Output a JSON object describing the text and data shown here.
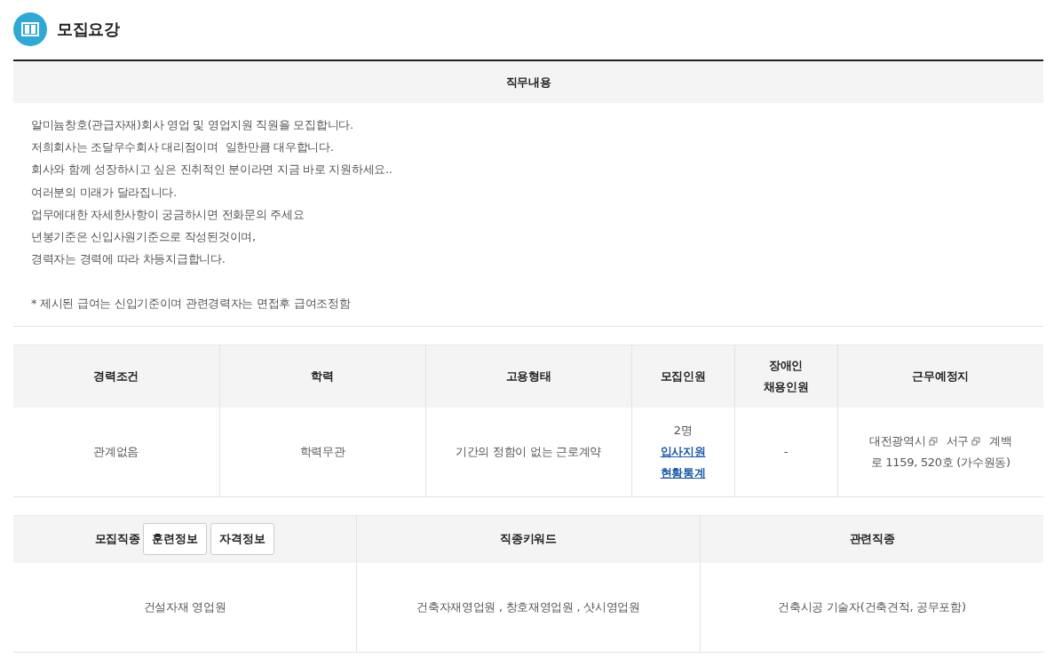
{
  "section_title": "모집요강",
  "job_description": {
    "heading": "직무내용",
    "lines": [
      "알미늄창호(관급자재)회사 영업 및 영업지원 직원을 모집합니다.",
      "저희회사는 조달우수회사 대리점이며  일한만큼 대우합니다.",
      "회사와 함께 성장하시고 싶은 진취적인 분이라면 지금 바로 지원하세요..",
      "여러분의 미래가 달라집니다.",
      "업무에대한 자세한사항이 궁금하시면 전화문의 주세요",
      "년봉기준은 신입사원기준으로 작성된것이며,",
      "경력자는 경력에 따라 차등지급합니다."
    ],
    "note": "* 제시된 급여는 신입기준이며 관련경력자는 면접후 급여조정함"
  },
  "conditions": {
    "columns": [
      "경력조건",
      "학력",
      "고용형태",
      "모집인원",
      [
        "장애인",
        "채용인원"
      ],
      "근무예정지"
    ],
    "experience": "관계없음",
    "education": "학력무관",
    "employment_type": "기간의 정함이 없는 근로계약",
    "headcount": "2명",
    "headcount_link": "입사지원 현황통계",
    "disabled_hiring": "-",
    "location": {
      "parts": [
        "대전광역시",
        "서구"
      ],
      "rest_lines": [
        "계백",
        "로 1159, 520호 (가수원동)"
      ]
    }
  },
  "occupation": {
    "columns": [
      "모집직종",
      "직종키워드",
      "관련직종"
    ],
    "header_buttons": [
      "훈련정보",
      "자격정보"
    ],
    "row": [
      "건설자재 영업원",
      "건축자재영업원 , 창호재영업원 , 샷시영업원",
      "건축시공 기술자(건축견적, 공무포함)"
    ]
  }
}
